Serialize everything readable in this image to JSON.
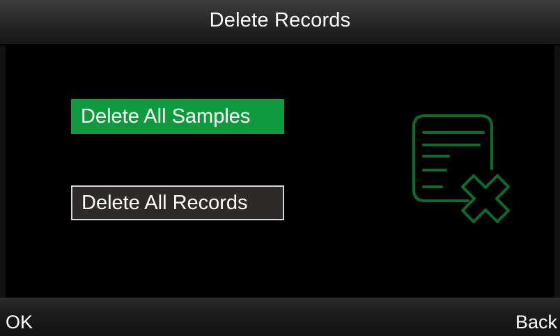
{
  "header": {
    "title": "Delete Records"
  },
  "menu": {
    "items": [
      {
        "label": "Delete All Samples",
        "selected": true
      },
      {
        "label": "Delete All Records",
        "selected": false
      }
    ]
  },
  "icon": {
    "name": "delete-document-icon",
    "color": "#0f6b2b"
  },
  "softkeys": {
    "left_label": "OK",
    "right_label": "Back"
  },
  "colors": {
    "selected_bg": "#109a3e",
    "unselected_bg": "#2f2a2a",
    "background": "#000000"
  }
}
